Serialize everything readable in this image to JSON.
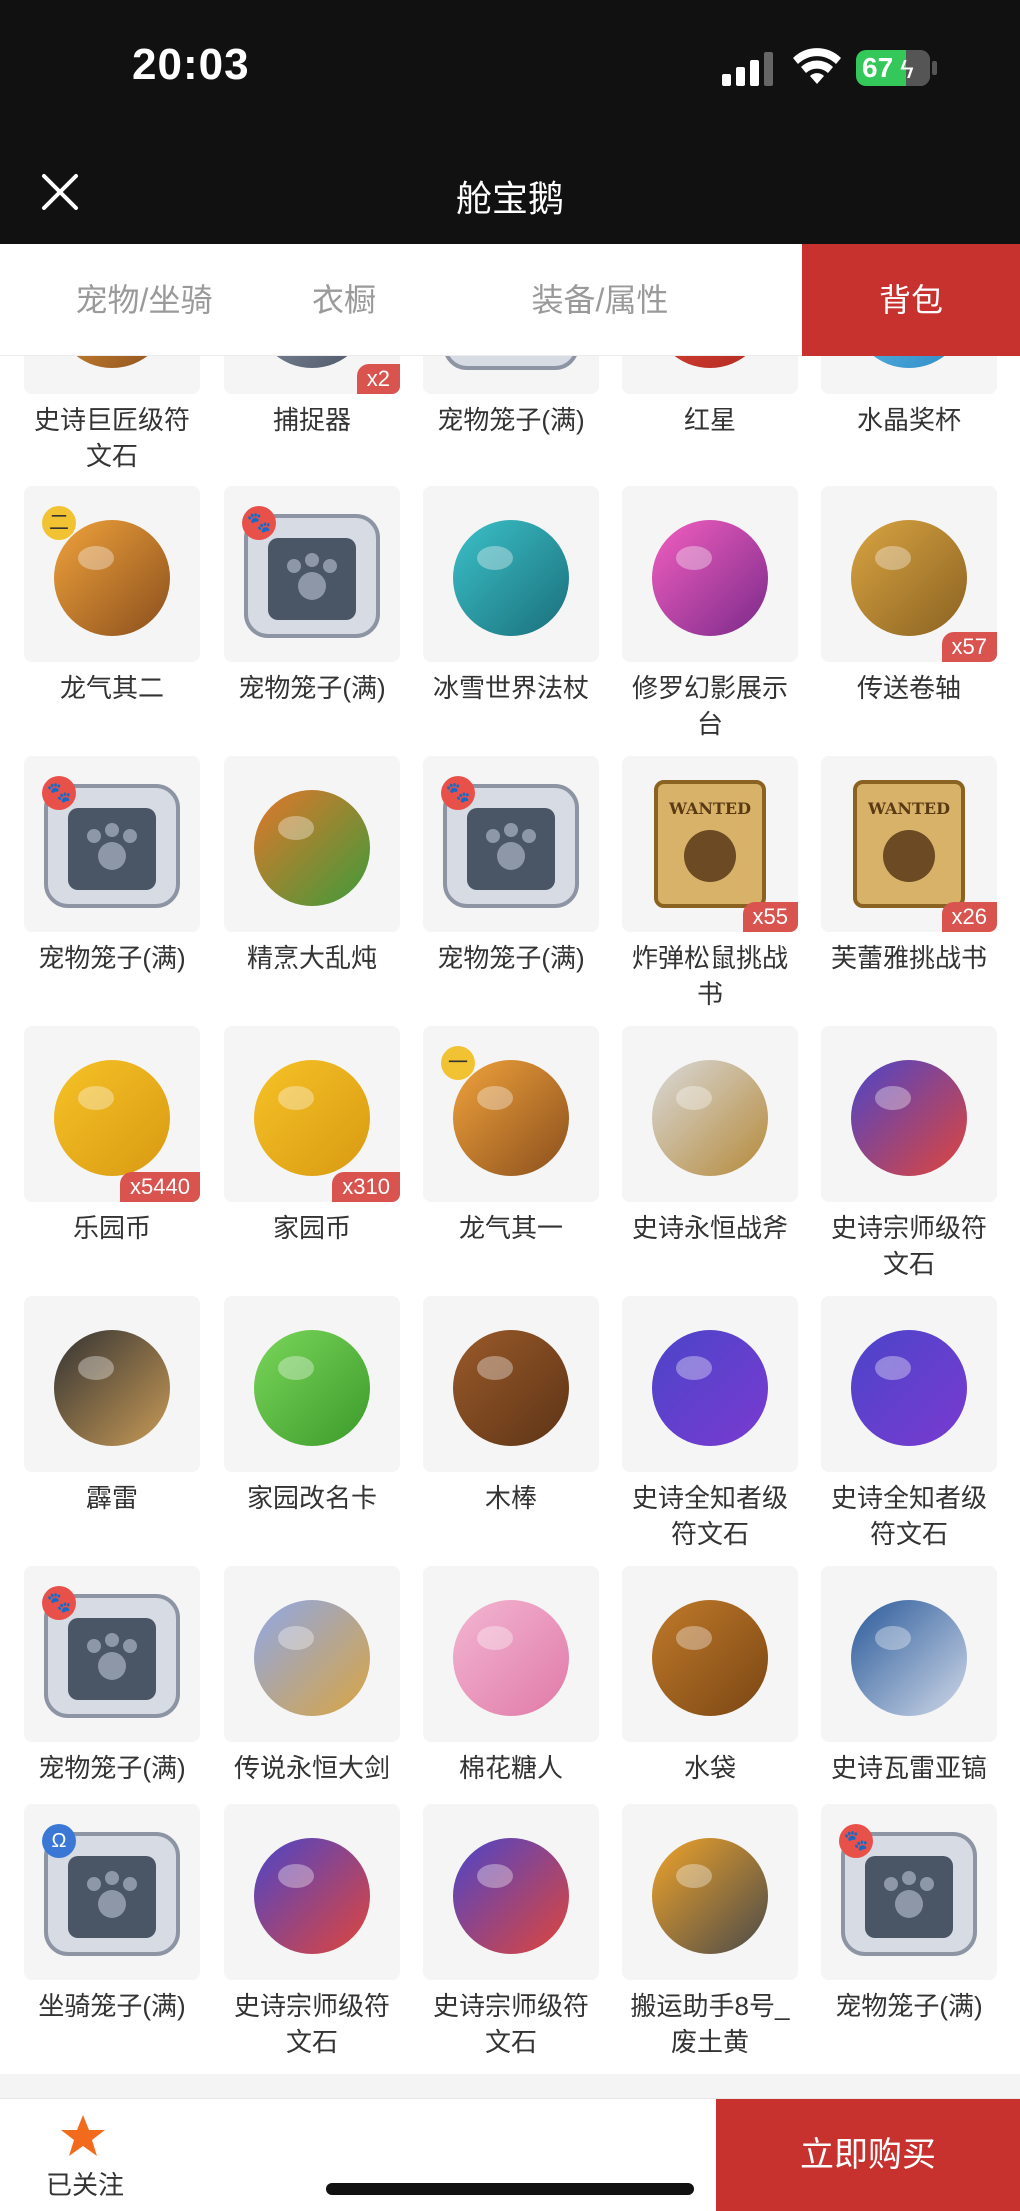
{
  "status_bar": {
    "time": "20:03",
    "battery": "67"
  },
  "header": {
    "title": "舱宝鹅"
  },
  "tabs": [
    {
      "label": "宠物/坐骑"
    },
    {
      "label": "衣橱"
    },
    {
      "label": "装备/属性"
    },
    {
      "label": "背包"
    }
  ],
  "items": [
    {
      "label": "史诗巨匠级符文石",
      "badge": ""
    },
    {
      "label": "捕捉器",
      "badge": "x2"
    },
    {
      "label": "宠物笼子(满)",
      "badge": ""
    },
    {
      "label": "红星",
      "badge": ""
    },
    {
      "label": "水晶奖杯",
      "badge": ""
    },
    {
      "label": "龙气其二",
      "badge": "",
      "tag": "二"
    },
    {
      "label": "宠物笼子(满)",
      "badge": "",
      "tag": "🐾"
    },
    {
      "label": "冰雪世界法杖",
      "badge": ""
    },
    {
      "label": "修罗幻影展示台",
      "badge": ""
    },
    {
      "label": "传送卷轴",
      "badge": "x57"
    },
    {
      "label": "宠物笼子(满)",
      "badge": "",
      "tag": "🐾"
    },
    {
      "label": "精烹大乱炖",
      "badge": ""
    },
    {
      "label": "宠物笼子(满)",
      "badge": "",
      "tag": "🐾"
    },
    {
      "label": "炸弹松鼠挑战书",
      "badge": "x55",
      "poster": "WANTED"
    },
    {
      "label": "芙蕾雅挑战书",
      "badge": "x26",
      "poster": "WANTED"
    },
    {
      "label": "乐园币",
      "badge": "x5440"
    },
    {
      "label": "家园币",
      "badge": "x310"
    },
    {
      "label": "龙气其一",
      "badge": "",
      "tag": "一"
    },
    {
      "label": "史诗永恒战斧",
      "badge": ""
    },
    {
      "label": "史诗宗师级符文石",
      "badge": ""
    },
    {
      "label": "霹雷",
      "badge": ""
    },
    {
      "label": "家园改名卡",
      "badge": ""
    },
    {
      "label": "木棒",
      "badge": ""
    },
    {
      "label": "史诗全知者级符文石",
      "badge": ""
    },
    {
      "label": "史诗全知者级符文石",
      "badge": ""
    },
    {
      "label": "宠物笼子(满)",
      "badge": "",
      "tag": "🐾"
    },
    {
      "label": "传说永恒大剑",
      "badge": ""
    },
    {
      "label": "棉花糖人",
      "badge": ""
    },
    {
      "label": "水袋",
      "badge": ""
    },
    {
      "label": "史诗瓦雷亚镐",
      "badge": ""
    },
    {
      "label": "坐骑笼子(满)",
      "badge": "",
      "tag": "Ω"
    },
    {
      "label": "史诗宗师级符文石",
      "badge": ""
    },
    {
      "label": "史诗宗师级符文石",
      "badge": ""
    },
    {
      "label": "搬运助手8号_废土黄",
      "badge": ""
    },
    {
      "label": "宠物笼子(满)",
      "badge": "",
      "tag": "🐾"
    }
  ],
  "bottom_bar": {
    "follow_label": "已关注",
    "buy_label": "立即购买"
  },
  "colors": {
    "accent": "#c7322f",
    "badge": "#d9534f",
    "header_bg": "#111111"
  }
}
